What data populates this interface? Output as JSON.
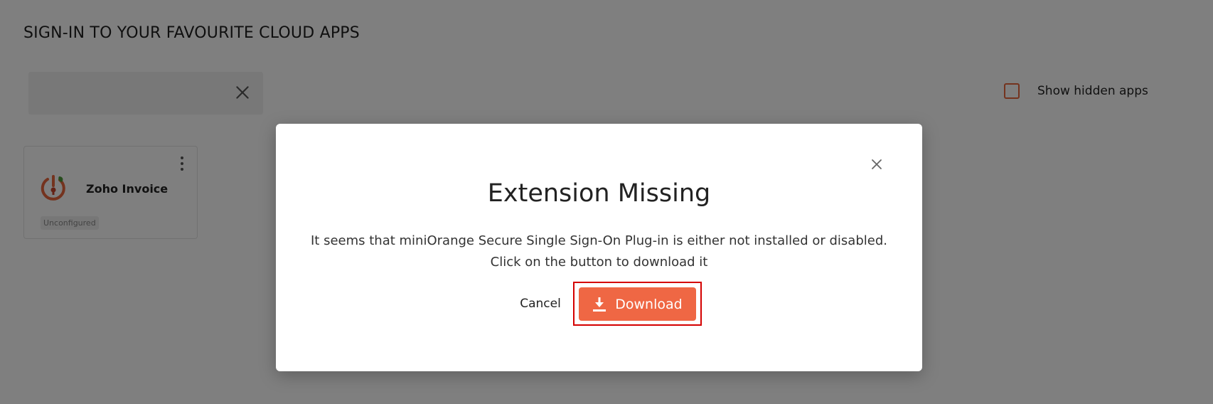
{
  "page": {
    "title": "SIGN-IN TO YOUR FAVOURITE CLOUD APPS"
  },
  "search": {
    "value": "",
    "placeholder": "",
    "clear_icon": "close-icon"
  },
  "filters": {
    "show_hidden_label": "Show hidden apps",
    "show_hidden_checked": false
  },
  "apps": [
    {
      "name": "Zoho Invoice",
      "status": "Unconfigured",
      "logo_icon": "zoho-invoice-logo",
      "menu_icon": "more-vertical-icon"
    }
  ],
  "modal": {
    "title": "Extension Missing",
    "message_line1": "It seems that miniOrange Secure Single Sign-On Plug-in is either not installed or disabled.",
    "message_line2": "Click on the button to download it",
    "cancel_label": "Cancel",
    "download_label": "Download",
    "download_icon": "download-icon",
    "close_icon": "close-icon"
  },
  "colors": {
    "accent": "#ef6744",
    "highlight_border": "#d40000",
    "checkbox_border": "#e8663d",
    "overlay": "rgba(0,0,0,0.5)"
  }
}
